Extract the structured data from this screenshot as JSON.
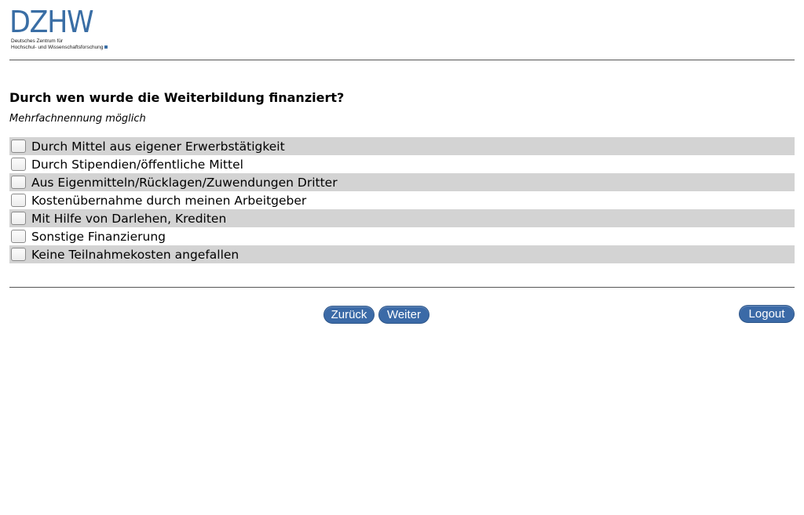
{
  "logo": {
    "wordmark": "DZHW",
    "subtitle_line1": "Deutsches Zentrum für",
    "subtitle_line2": "Hochschul- und Wissenschaftsforschung",
    "color": "#3a6ea5"
  },
  "question": {
    "title": "Durch wen wurde die Weiterbildung finanziert?",
    "instruction": "Mehrfachnennung möglich"
  },
  "options": [
    {
      "label": "Durch Mittel aus eigener Erwerbstätigkeit",
      "checked": false
    },
    {
      "label": "Durch Stipendien/öffentliche Mittel",
      "checked": false
    },
    {
      "label": "Aus Eigenmitteln/Rücklagen/Zuwendungen Dritter",
      "checked": false
    },
    {
      "label": "Kostenübernahme durch meinen Arbeitgeber",
      "checked": false
    },
    {
      "label": "Mit Hilfe von Darlehen, Krediten",
      "checked": false
    },
    {
      "label": "Sonstige Finanzierung",
      "checked": false
    },
    {
      "label": "Keine Teilnahmekosten angefallen",
      "checked": false
    }
  ],
  "navigation": {
    "back_label": "Zurück",
    "next_label": "Weiter",
    "logout_label": "Logout",
    "button_color": "#3b6aa7"
  }
}
